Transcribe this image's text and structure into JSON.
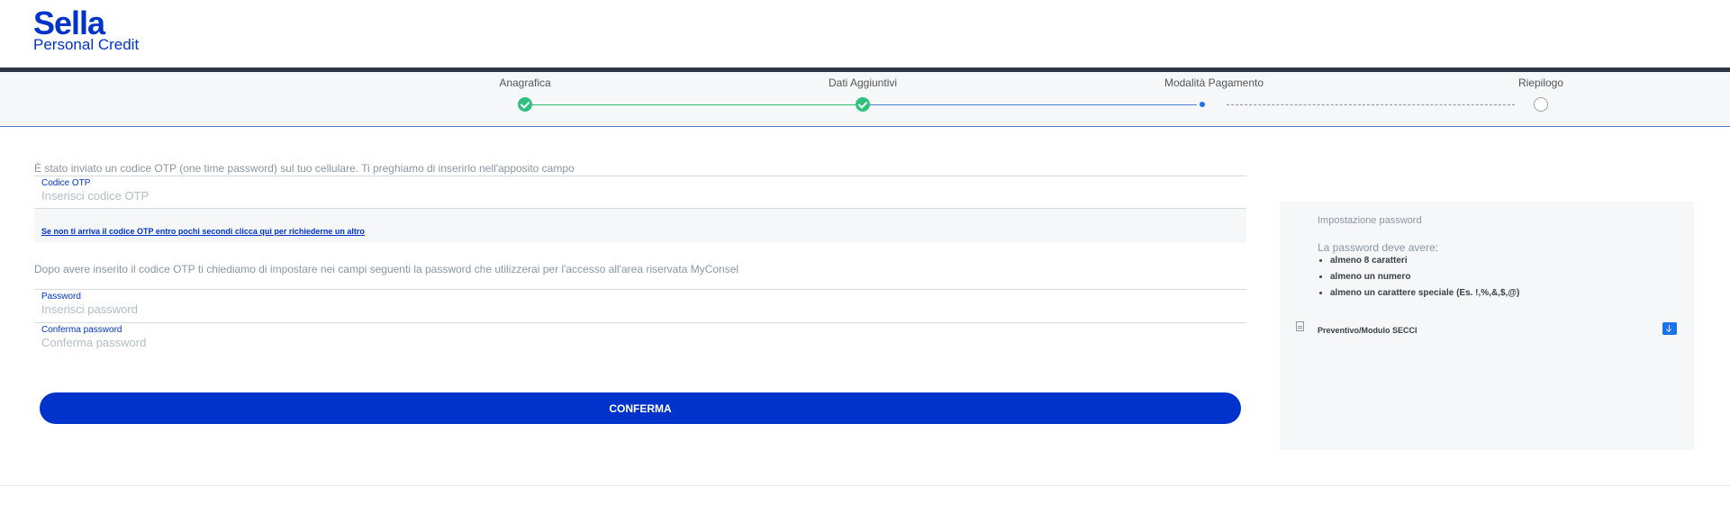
{
  "brand": {
    "name": "Sella",
    "sub": "Personal Credit"
  },
  "steps": [
    {
      "label": "Anagrafica",
      "state": "done"
    },
    {
      "label": "Dati Aggiuntivi",
      "state": "done"
    },
    {
      "label": "Modalità Pagamento",
      "state": "active"
    },
    {
      "label": "Riepilogo",
      "state": "todo"
    }
  ],
  "otp": {
    "intro": "È stato inviato un codice OTP (one time password) sul tuo cellulare. Ti preghiamo di inserirlo nell'apposito campo",
    "label": "Codice OTP",
    "placeholder": "Inserisci codice OTP",
    "resend_link": "Se non ti arriva il codice OTP entro pochi secondi clicca qui per richiederne un altro"
  },
  "password_section": {
    "intro": "Dopo avere inserito il codice OTP ti chiediamo di impostare nei campi seguenti la password che utilizzerai per l'accesso all'area riservata MyConsel",
    "password_label": "Password",
    "password_placeholder": "Inserisci password",
    "confirm_label": "Conferma password",
    "confirm_placeholder": "Conferma password"
  },
  "confirm_button": "CONFERMA",
  "side": {
    "title": "Impostazione password",
    "requirements_heading": "La password deve avere:",
    "requirements": [
      "almeno 8 caratteri",
      "almeno un numero",
      "almeno un carattere speciale (Es. !,%,&,$,@)"
    ],
    "document_label": "Preventivo/Modulo SECCI"
  },
  "colors": {
    "brand_blue": "#0033cc",
    "done_green": "#2ec27e",
    "active_blue": "#1a73e8",
    "navy": "#2d3748"
  }
}
